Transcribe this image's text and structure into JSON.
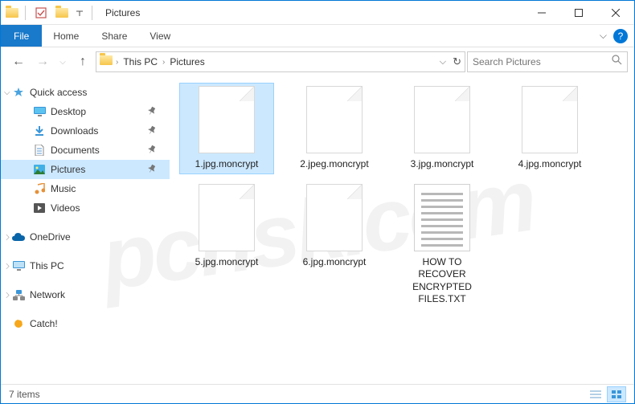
{
  "title": "Pictures",
  "ribbon": {
    "file": "File",
    "tabs": [
      "Home",
      "Share",
      "View"
    ]
  },
  "breadcrumb": [
    "This PC",
    "Pictures"
  ],
  "search": {
    "placeholder": "Search Pictures"
  },
  "nav": {
    "quickAccess": {
      "label": "Quick access",
      "children": [
        {
          "label": "Desktop",
          "pinned": true,
          "icon": "desktop"
        },
        {
          "label": "Downloads",
          "pinned": true,
          "icon": "downloads"
        },
        {
          "label": "Documents",
          "pinned": true,
          "icon": "documents"
        },
        {
          "label": "Pictures",
          "pinned": true,
          "icon": "pictures",
          "selected": true
        },
        {
          "label": "Music",
          "pinned": false,
          "icon": "music"
        },
        {
          "label": "Videos",
          "pinned": false,
          "icon": "videos"
        }
      ]
    },
    "oneDrive": {
      "label": "OneDrive"
    },
    "thisPC": {
      "label": "This PC"
    },
    "network": {
      "label": "Network"
    },
    "catch": {
      "label": "Catch!"
    }
  },
  "files": [
    {
      "name": "1.jpg.moncrypt",
      "type": "blank",
      "selected": true
    },
    {
      "name": "2.jpeg.moncrypt",
      "type": "blank"
    },
    {
      "name": "3.jpg.moncrypt",
      "type": "blank"
    },
    {
      "name": "4.jpg.moncrypt",
      "type": "blank"
    },
    {
      "name": "5.jpg.moncrypt",
      "type": "blank"
    },
    {
      "name": "6.jpg.moncrypt",
      "type": "blank"
    },
    {
      "name": "HOW TO RECOVER ENCRYPTED FILES.TXT",
      "type": "txt"
    }
  ],
  "status": {
    "itemCount": "7 items"
  },
  "watermark": "pcrisk.com"
}
